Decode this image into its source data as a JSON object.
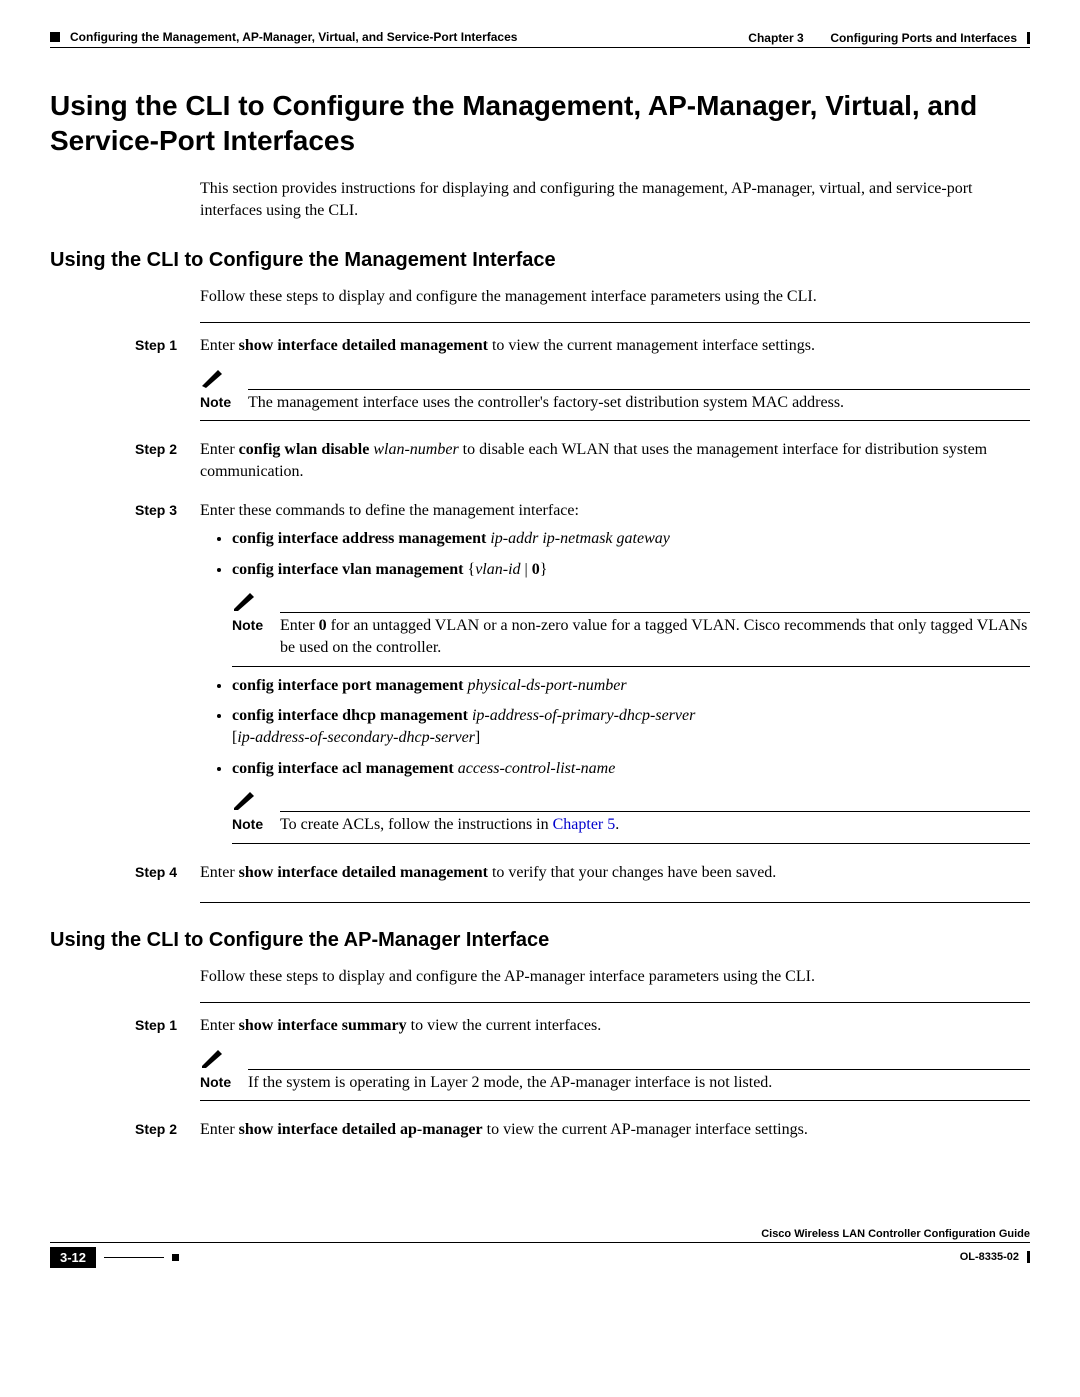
{
  "header": {
    "chapter_label": "Chapter 3",
    "chapter_title": "Configuring Ports and Interfaces",
    "section_title": "Configuring the Management, AP-Manager, Virtual, and Service-Port Interfaces"
  },
  "h1": "Using the CLI to Configure the Management, AP-Manager, Virtual, and Service-Port Interfaces",
  "intro1": "This section provides instructions for displaying and configuring the management, AP-manager, virtual, and service-port interfaces using the CLI.",
  "sec1": {
    "title": "Using the CLI to Configure the Management Interface",
    "intro": "Follow these steps to display and configure the management interface parameters using the CLI.",
    "step1": {
      "label": "Step 1",
      "lead": "Enter ",
      "cmd": "show interface detailed management",
      "tail": " to view the current management interface settings.",
      "note_label": "Note",
      "note_text": "The management interface uses the controller's factory-set distribution system MAC address."
    },
    "step2": {
      "label": "Step 2",
      "lead": "Enter ",
      "cmd": "config wlan disable",
      "arg": " wlan-number",
      "tail": " to disable each WLAN that uses the management interface for distribution system communication."
    },
    "step3": {
      "label": "Step 3",
      "lead": "Enter these commands to define the management interface:",
      "b1_cmd": "config interface address management",
      "b1_arg": " ip-addr ip-netmask gateway",
      "b2_cmd": "config interface vlan management",
      "b2_brace_open": " {",
      "b2_arg": "vlan-id",
      "b2_sep": " | ",
      "b2_zero": "0",
      "b2_brace_close": "}",
      "note2_label": "Note",
      "note2_a": "Enter ",
      "note2_zero": "0",
      "note2_b": " for an untagged VLAN or a non-zero value for a tagged VLAN. Cisco recommends that only tagged VLANs be used on the controller.",
      "b3_cmd": "config interface port management",
      "b3_arg": " physical-ds-port-number",
      "b4_cmd": "config interface dhcp management",
      "b4_arg": " ip-address-of-primary-dhcp-server",
      "b4_opt_open": "[",
      "b4_opt_arg": "ip-address-of-secondary-dhcp-server",
      "b4_opt_close": "]",
      "b5_cmd": "config interface acl management",
      "b5_arg": " access-control-list-name",
      "note3_label": "Note",
      "note3_a": "To create ACLs, follow the instructions in ",
      "note3_link": "Chapter 5",
      "note3_b": "."
    },
    "step4": {
      "label": "Step 4",
      "lead": "Enter ",
      "cmd": "show interface detailed management",
      "tail": " to verify that your changes have been saved."
    }
  },
  "sec2": {
    "title": "Using the CLI to Configure the AP-Manager Interface",
    "intro": "Follow these steps to display and configure the AP-manager interface parameters using the CLI.",
    "step1": {
      "label": "Step 1",
      "lead": "Enter ",
      "cmd": "show interface summary",
      "tail": " to view the current interfaces.",
      "note_label": "Note",
      "note_text": "If the system is operating in Layer 2 mode, the AP-manager interface is not listed."
    },
    "step2": {
      "label": "Step 2",
      "lead": "Enter ",
      "cmd": "show interface detailed ap-manager",
      "tail": " to view the current AP-manager interface settings."
    }
  },
  "footer": {
    "guide": "Cisco Wireless LAN Controller Configuration Guide",
    "pagenum": "3-12",
    "docid": "OL-8335-02"
  }
}
